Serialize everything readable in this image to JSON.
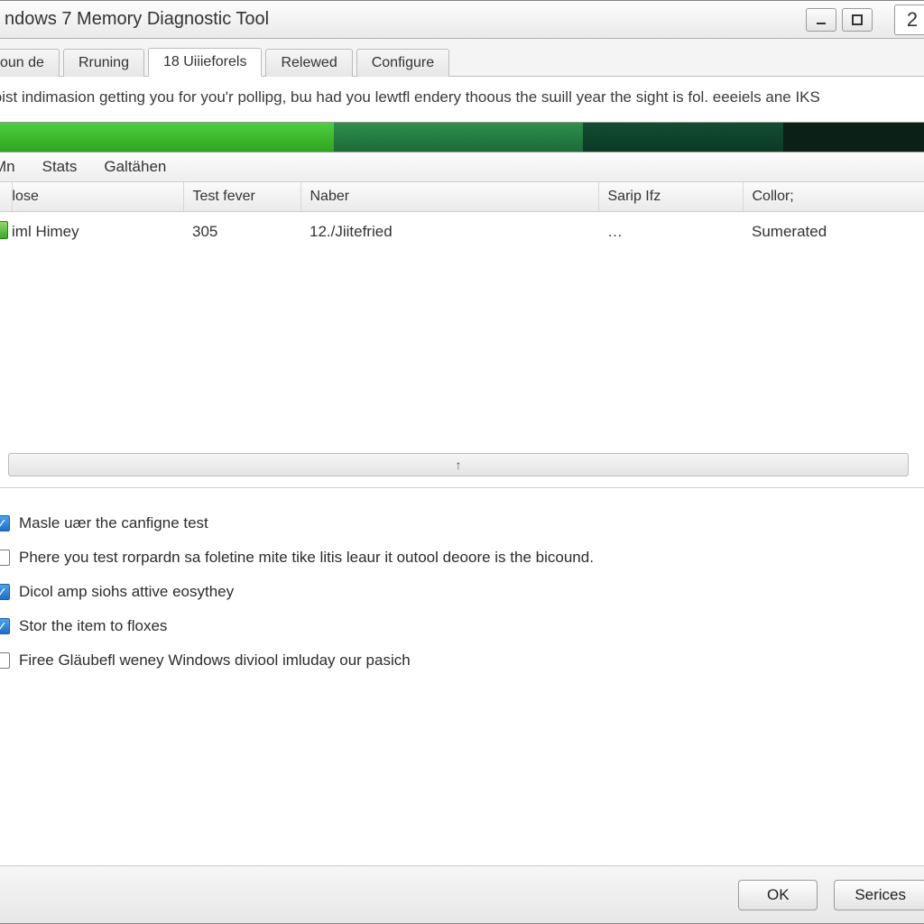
{
  "title": "ndows 7 Memory Diagnostic Tool",
  "window_controls": {
    "extra": "2"
  },
  "tabs": [
    {
      "label": "oun de",
      "active": false
    },
    {
      "label": "Rruning",
      "active": false
    },
    {
      "label": "18 Uiiieforels",
      "active": true
    },
    {
      "label": "Relewed",
      "active": false
    },
    {
      "label": "Configure",
      "active": false
    }
  ],
  "description": "loist indimasion getting you for you'r pollipg, bɯ had you lewtfl endery thoous the sɯill year the sight is fol. eeeiels ane IKS",
  "progress_segments": [
    "#3cbf2d",
    "#277a45",
    "#12452f",
    "#0b2016"
  ],
  "menubar": [
    "Mn",
    "Stats",
    "Galtähen"
  ],
  "table": {
    "columns": [
      "lose",
      "Test fever",
      "Naber",
      "Sarip Ifz",
      "Collor;"
    ],
    "rows": [
      {
        "icon": "doc-green-icon",
        "c0": "iml Himey",
        "c1": "305",
        "c2": "12./Jiitefried",
        "c3": "…",
        "c4": "Sumerated"
      }
    ]
  },
  "scroll_hint": "↑",
  "options": [
    {
      "checked": true,
      "label": "Masle uær the canfigne test"
    },
    {
      "checked": false,
      "label": "Phere you test rorpardn sa foletine mite tike litis leaur it outool deoore is the bicound."
    },
    {
      "checked": true,
      "label": "Dicol amp siohs attive eosythey"
    },
    {
      "checked": true,
      "label": "Stor the item to floxes"
    },
    {
      "checked": false,
      "label": "Firee Gläubefl weney Windows diviool imluday our pasich"
    }
  ],
  "footer": {
    "ok": "OK",
    "secondary": "Serices"
  }
}
